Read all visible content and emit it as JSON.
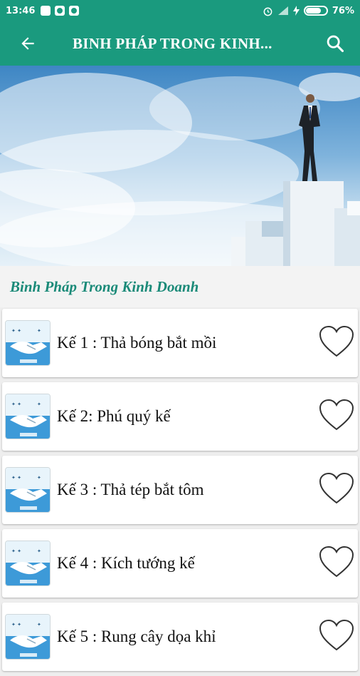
{
  "status_bar": {
    "time": "13:46",
    "battery_percent": "76%",
    "battery_level": 0.76,
    "icons": [
      "sim-icon",
      "notification-icon",
      "android-icon",
      "alarm-icon",
      "signal-icon",
      "charging-icon",
      "battery-icon"
    ]
  },
  "app_bar": {
    "title": "BINH PHÁP TRONG KINH...",
    "back_icon": "back-arrow-icon",
    "search_icon": "search-icon",
    "color": "#1a9a7e"
  },
  "subtitle": "Binh Pháp Trong Kinh Doanh",
  "items": [
    {
      "label": "Kế 1 : Thả bóng bắt mồi"
    },
    {
      "label": "Kế 2: Phú quý kế"
    },
    {
      "label": "Kế 3 : Thả tép bắt tôm"
    },
    {
      "label": "Kế 4 : Kích tướng kế"
    },
    {
      "label": "Kế 5 : Rung cây dọa khỉ"
    }
  ]
}
